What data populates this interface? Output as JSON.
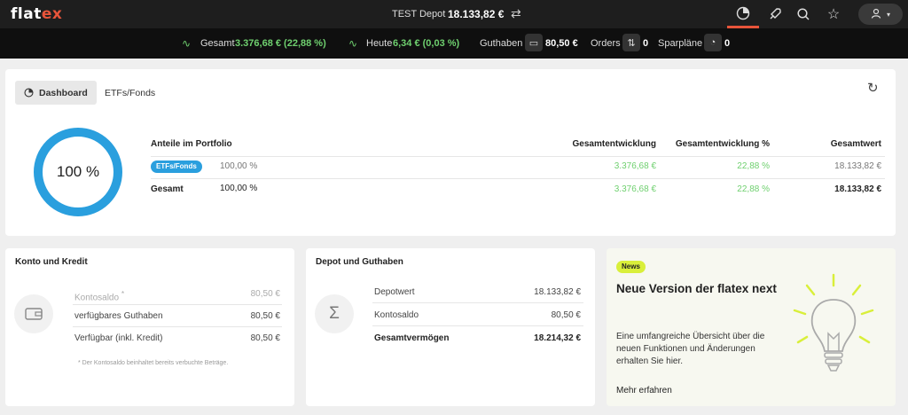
{
  "topbar": {
    "logo_main": "flat",
    "logo_accent": "ex",
    "depot_label": "TEST Depot",
    "depot_value": "18.133,82 €",
    "icons": [
      "swap-icon",
      "dashboard-icon",
      "rocket-icon",
      "search-icon",
      "star-icon",
      "user-icon",
      "chevron-down-icon"
    ]
  },
  "statbar": {
    "gesamt_label": "Gesamt",
    "gesamt_value": "3.376,68 € (22,88 %)",
    "heute_label": "Heute",
    "heute_value": "6,34 € (0,03 %)",
    "guthaben_label": "Guthaben",
    "guthaben_value": "80,50 €",
    "orders_label": "Orders",
    "orders_value": "0",
    "sparplaene_label": "Sparpläne",
    "sparplaene_value": "0"
  },
  "tabs": [
    {
      "label": "Dashboard",
      "active": true
    },
    {
      "label": "ETFs/Fonds",
      "active": false
    }
  ],
  "portfolio": {
    "donut_label": "100 %",
    "headers": {
      "anteile": "Anteile im Portfolio",
      "entwicklung": "Gesamtentwicklung",
      "entwicklung_pct": "Gesamtentwicklung %",
      "wert": "Gesamtwert"
    },
    "rows": [
      {
        "name": "ETFs/Fonds",
        "anteil": "100,00 %",
        "entwicklung": "3.376,68 €",
        "entwicklung_pct": "22,88 %",
        "wert": "18.133,82 €"
      },
      {
        "name": "Gesamt",
        "anteil": "100,00 %",
        "entwicklung": "3.376,68 €",
        "entwicklung_pct": "22,88 %",
        "wert": "18.133,82 €"
      }
    ]
  },
  "konto": {
    "title": "Konto und Kredit",
    "rows": [
      {
        "label": "Kontosaldo",
        "sup": "*",
        "value": "80,50 €"
      },
      {
        "label": "verfügbares Guthaben",
        "value": "80,50 €"
      },
      {
        "label": "Verfügbar (inkl. Kredit)",
        "value": "80,50 €"
      }
    ],
    "footnote": "* Der Kontosaldo beinhaltet bereits verbuchte Beträge."
  },
  "depot_card": {
    "title": "Depot und Guthaben",
    "rows": [
      {
        "label": "Depotwert",
        "value": "18.133,82 €"
      },
      {
        "label": "Kontosaldo",
        "value": "80,50 €"
      },
      {
        "label": "Gesamtvermögen",
        "value": "18.214,32 €"
      }
    ]
  },
  "news": {
    "badge": "News",
    "title": "Neue Version der flatex next",
    "body": "Eine umfangreiche Übersicht über die neuen Funktionen und Änderungen erhalten Sie hier.",
    "link": "Mehr erfahren"
  },
  "colors": {
    "accent": "#e8543a",
    "positive": "#6fd06f",
    "chart_blue": "#2a9fde",
    "news_badge": "#d9ef3a"
  }
}
